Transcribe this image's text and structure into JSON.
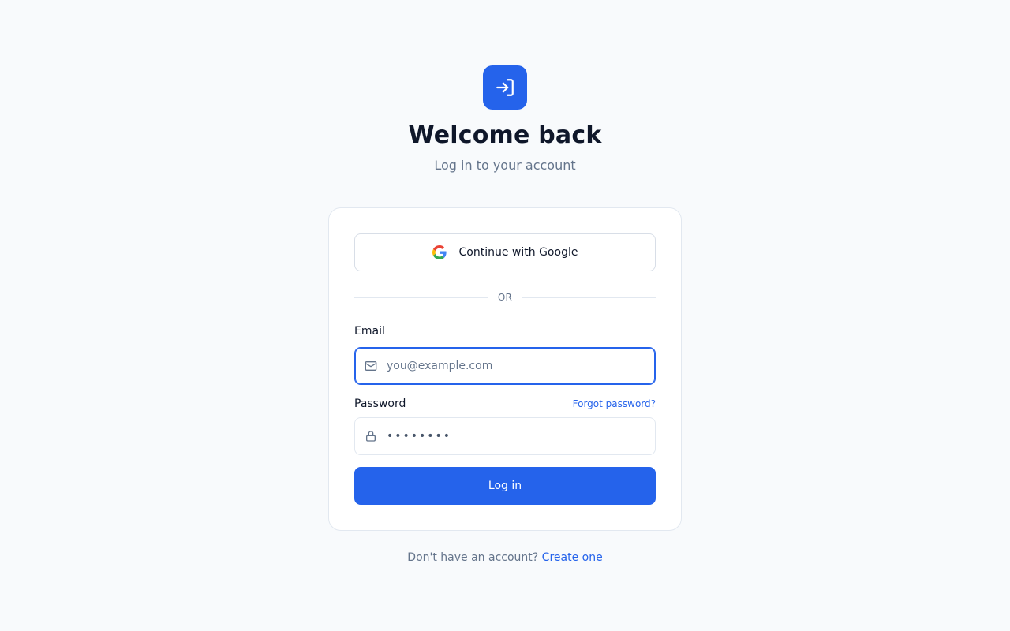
{
  "header": {
    "logo_icon": "login-arrow-icon",
    "title": "Welcome back",
    "subtitle": "Log in to your account"
  },
  "card": {
    "google_button": {
      "icon": "google-icon",
      "label": "Continue with Google"
    },
    "divider_text": "OR",
    "email": {
      "label": "Email",
      "icon": "mail-icon",
      "placeholder": "you@example.com",
      "value": ""
    },
    "password": {
      "label": "Password",
      "icon": "lock-icon",
      "forgot_label": "Forgot password?",
      "value": "••••••••"
    },
    "submit_label": "Log in"
  },
  "footer": {
    "prompt": "Don't have an account?",
    "link_label": "Create one"
  },
  "colors": {
    "accent": "#2563eb",
    "background": "#f8fafc",
    "text": "#0f172a",
    "muted": "#64748b",
    "border": "#e2e8f0"
  }
}
